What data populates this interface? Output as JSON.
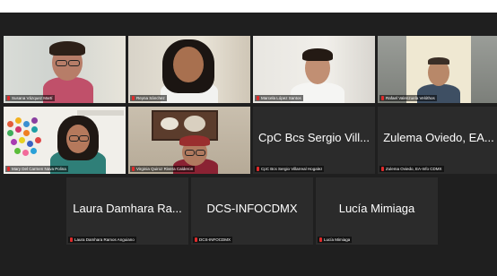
{
  "participants": [
    {
      "id": "p1",
      "label": "Susana Vázquez Martí",
      "big": ""
    },
    {
      "id": "p2",
      "label": "Reyna Sánchez",
      "big": ""
    },
    {
      "id": "p3",
      "label": "Marcela López Santos",
      "big": ""
    },
    {
      "id": "p4",
      "label": "Rafael Valenzuela Velóthos",
      "big": ""
    },
    {
      "id": "p5",
      "label": "Mary Del Carmen Nava Polina",
      "big": ""
    },
    {
      "id": "p6",
      "label": "Virginia Quiroz Rivera Calderon",
      "big": ""
    },
    {
      "id": "p7",
      "label": "CpC Bcs Sergio Villarreal Hogalez",
      "big": "CpC Bcs Sergio Vill..."
    },
    {
      "id": "p8",
      "label": "Zulema Oviedo, EA-Info CDMX",
      "big": "Zulema Oviedo, EA..."
    },
    {
      "id": "p9",
      "label": "Laura Damhara Ramos Anguiano",
      "big": "Laura Damhara Ra..."
    },
    {
      "id": "p10",
      "label": "DCS-INFOCDMX",
      "big": "DCS-INFOCDMX"
    },
    {
      "id": "p11",
      "label": "Lucía Mimiaga",
      "big": "Lucía Mimiaga"
    }
  ],
  "colors": {
    "background": "#1f1f1f",
    "tile": "#2b2b2b",
    "mic_muted": "#e02b2b"
  },
  "icons": [
    "microphone-muted-icon"
  ]
}
